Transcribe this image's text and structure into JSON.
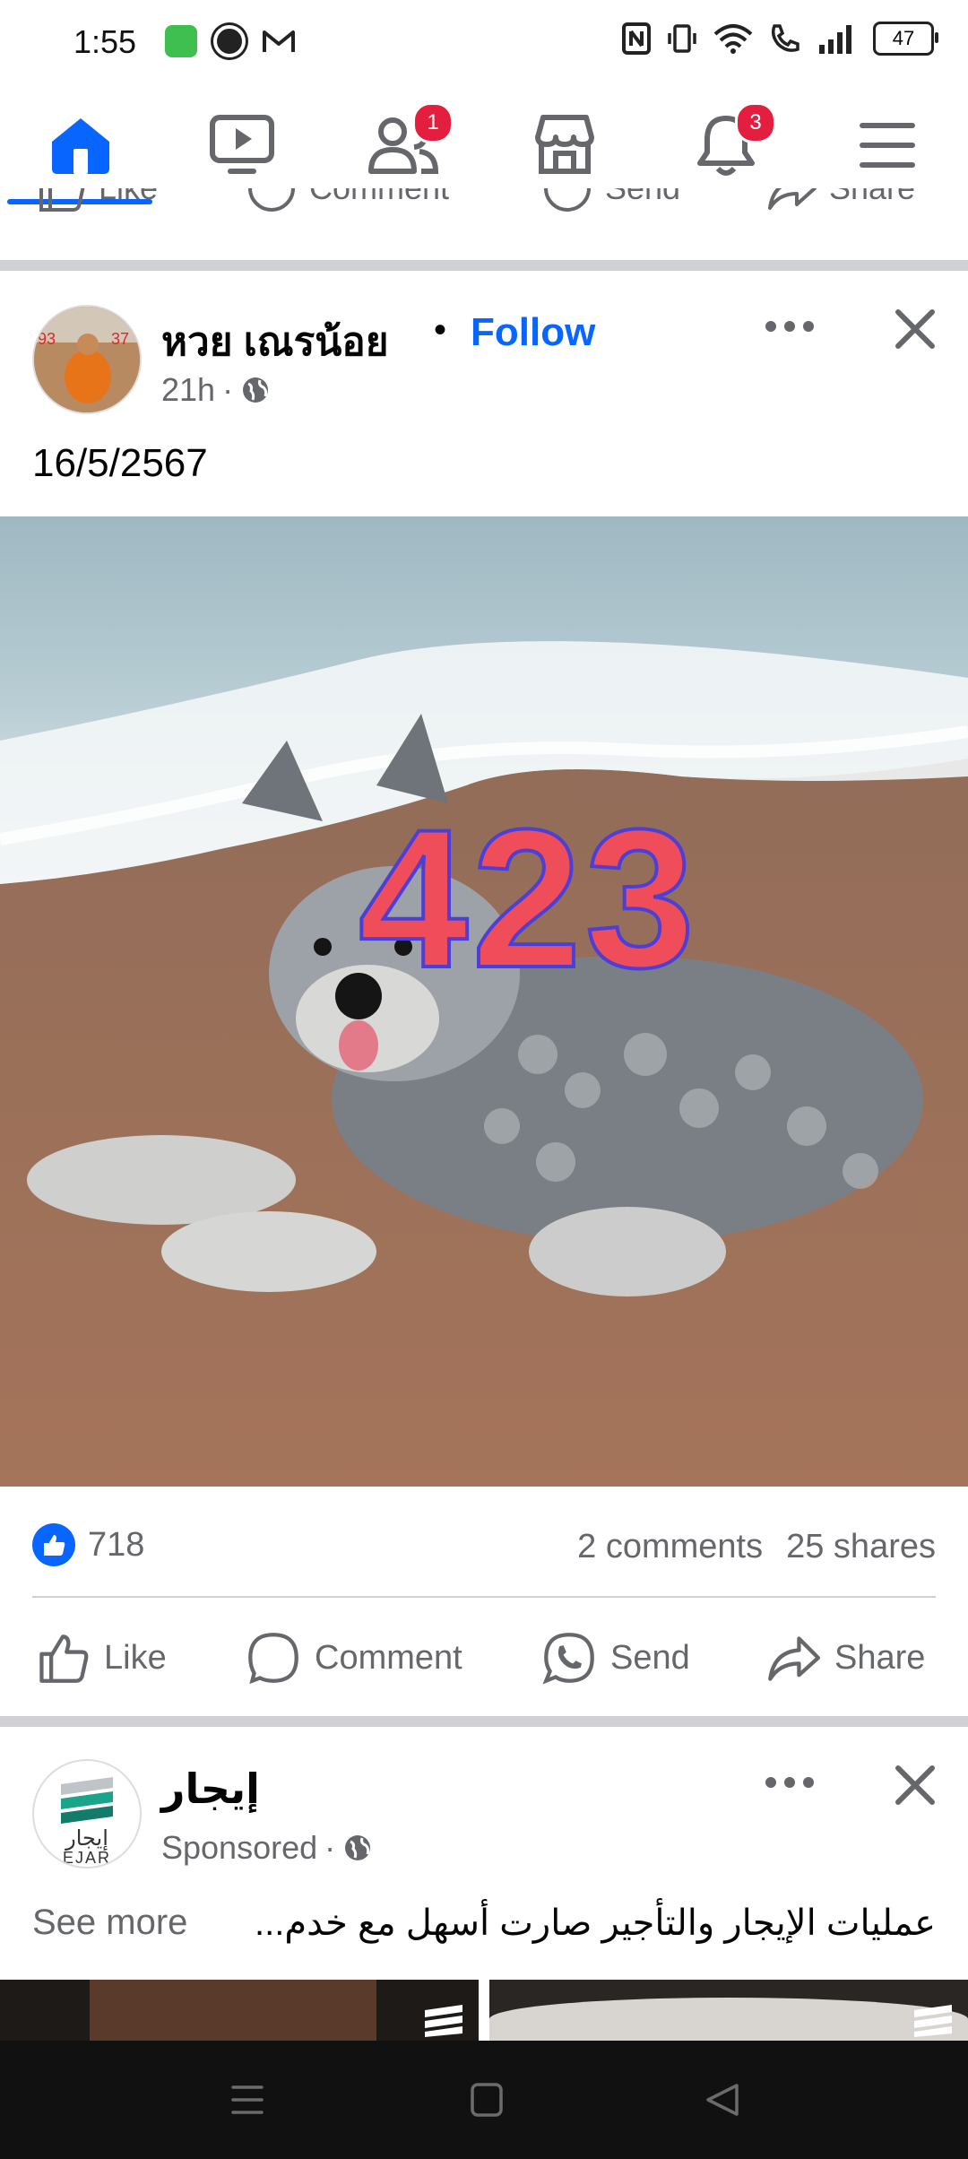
{
  "status_bar": {
    "time": "1:55",
    "battery": "47",
    "icons_left": [
      "app-icon",
      "chrome-icon",
      "gmail-icon"
    ],
    "icons_right": [
      "nfc-icon",
      "vibrate-icon",
      "wifi-icon",
      "wifi-call-icon",
      "signal-icon",
      "battery-icon"
    ]
  },
  "nav": {
    "items": [
      {
        "name": "home",
        "badge": ""
      },
      {
        "name": "video",
        "badge": ""
      },
      {
        "name": "friends",
        "badge": "1"
      },
      {
        "name": "marketplace",
        "badge": ""
      },
      {
        "name": "notifications",
        "badge": "3"
      },
      {
        "name": "menu",
        "badge": ""
      }
    ],
    "active": "home"
  },
  "prev_post_actions": {
    "like": "Like",
    "comment": "Comment",
    "send": "Send",
    "share": "Share"
  },
  "post": {
    "author": "หวย เณรน้อย",
    "separator": "•",
    "follow": "Follow",
    "time": "21h",
    "meta_sep": "·",
    "text": "16/5/2567",
    "image_number": "423",
    "reactions_count": "718",
    "comments": "2 comments",
    "shares": "25 shares",
    "actions": {
      "like": "Like",
      "comment": "Comment",
      "send": "Send",
      "share": "Share"
    }
  },
  "sponsored": {
    "name": "إيجار",
    "label": "Sponsored",
    "meta_sep": "·",
    "logo_text": "إيجار",
    "logo_subtext": "EJAR",
    "text": "عمليات الإيجار والتأجير صارت أسهل مع خدم...",
    "see_more": "See more"
  },
  "colors": {
    "accent": "#0866ff",
    "badge": "#e41e3f",
    "secondary_text": "#65676b",
    "divider": "#ced0d4"
  }
}
